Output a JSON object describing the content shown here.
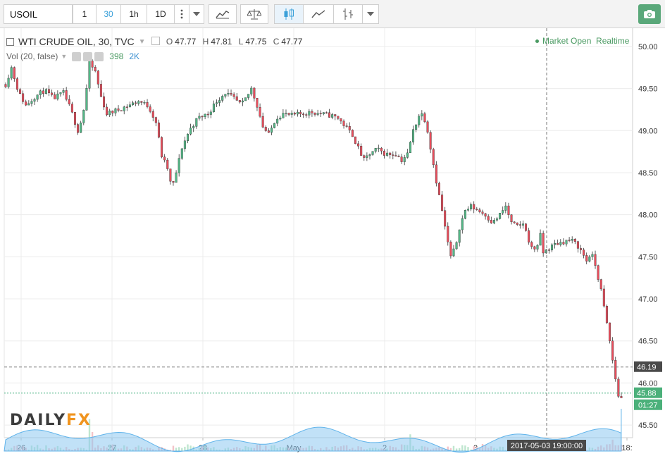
{
  "toolbar": {
    "symbol": "USOIL",
    "intervals": [
      "1",
      "30",
      "1h",
      "1D"
    ],
    "active_interval": "30",
    "tools": [
      "more-vert-icon",
      "chevron-down-icon",
      "indicators-icon",
      "compare-icon",
      "candles-icon",
      "area-icon",
      "bars-icon",
      "chevron-down-icon"
    ],
    "camera_icon": "camera-icon"
  },
  "legend": {
    "title": "WTI CRUDE OIL, 30, TVC",
    "o_label": "O",
    "o": "47.77",
    "h_label": "H",
    "h": "47.81",
    "l_label": "L",
    "l": "47.75",
    "c_label": "C",
    "c": "47.77",
    "vol_label": "Vol (20, false)",
    "vol_value": "398",
    "vol_ma": "2K",
    "status": "Market Open",
    "feed": "Realtime"
  },
  "logo": {
    "part1": "DAILY",
    "part2": "FX"
  },
  "chart_data": {
    "type": "candlestick",
    "title": "WTI CRUDE OIL, 30, TVC",
    "ylim": [
      45.35,
      50.1
    ],
    "y_ticks": [
      "50.00",
      "49.50",
      "49.00",
      "48.50",
      "48.00",
      "47.50",
      "47.00",
      "46.50",
      "46.00",
      "45.50"
    ],
    "x_ticks": [
      "26",
      "27",
      "28",
      "May",
      "2",
      "3",
      "18:"
    ],
    "x_range_days": [
      0,
      5.85
    ],
    "crosshair": {
      "time_label": "2017-05-03 19:00:00",
      "time_days": 5.78,
      "price_label": "46.19",
      "price": 46.19
    },
    "last_price": {
      "label": "45.88",
      "value": 45.88
    },
    "countdown": "01:27",
    "colors": {
      "up": "#53b987",
      "down": "#eb4d5c",
      "volume_ma": "#8ec8f0"
    },
    "price_path": [
      [
        0.0,
        49.55
      ],
      [
        0.04,
        49.75
      ],
      [
        0.09,
        49.45
      ],
      [
        0.14,
        49.3
      ],
      [
        0.2,
        49.4
      ],
      [
        0.27,
        49.48
      ],
      [
        0.33,
        49.38
      ],
      [
        0.4,
        49.45
      ],
      [
        0.45,
        49.25
      ],
      [
        0.5,
        49.0
      ],
      [
        0.53,
        49.15
      ],
      [
        0.55,
        49.35
      ],
      [
        0.58,
        49.8
      ],
      [
        0.62,
        49.7
      ],
      [
        0.66,
        49.4
      ],
      [
        0.7,
        49.2
      ],
      [
        0.78,
        49.25
      ],
      [
        0.85,
        49.3
      ],
      [
        0.92,
        49.35
      ],
      [
        0.98,
        49.3
      ],
      [
        1.0,
        49.25
      ],
      [
        1.04,
        49.1
      ],
      [
        1.08,
        48.7
      ],
      [
        1.12,
        48.55
      ],
      [
        1.15,
        48.3
      ],
      [
        1.18,
        48.5
      ],
      [
        1.22,
        48.8
      ],
      [
        1.27,
        49.0
      ],
      [
        1.33,
        49.15
      ],
      [
        1.4,
        49.2
      ],
      [
        1.46,
        49.35
      ],
      [
        1.52,
        49.45
      ],
      [
        1.58,
        49.38
      ],
      [
        1.63,
        49.3
      ],
      [
        1.67,
        49.4
      ],
      [
        1.7,
        49.5
      ],
      [
        1.74,
        49.3
      ],
      [
        1.78,
        49.05
      ],
      [
        1.82,
        48.95
      ],
      [
        1.87,
        49.15
      ],
      [
        1.92,
        49.2
      ],
      [
        1.98,
        49.18
      ],
      [
        2.05,
        49.2
      ],
      [
        2.12,
        49.22
      ],
      [
        2.18,
        49.2
      ],
      [
        2.25,
        49.18
      ],
      [
        2.3,
        49.15
      ],
      [
        2.35,
        49.05
      ],
      [
        2.4,
        48.95
      ],
      [
        2.45,
        48.75
      ],
      [
        2.48,
        48.65
      ],
      [
        2.52,
        48.72
      ],
      [
        2.57,
        48.78
      ],
      [
        2.63,
        48.72
      ],
      [
        2.7,
        48.72
      ],
      [
        2.74,
        48.65
      ],
      [
        2.78,
        48.72
      ],
      [
        2.82,
        49.0
      ],
      [
        2.86,
        49.18
      ],
      [
        2.89,
        49.2
      ],
      [
        2.92,
        49.0
      ],
      [
        2.95,
        48.7
      ],
      [
        2.98,
        48.4
      ],
      [
        3.02,
        48.05
      ],
      [
        3.05,
        47.75
      ],
      [
        3.08,
        47.5
      ],
      [
        3.11,
        47.6
      ],
      [
        3.14,
        47.85
      ],
      [
        3.18,
        48.05
      ],
      [
        3.22,
        48.1
      ],
      [
        3.27,
        48.05
      ],
      [
        3.32,
        48.0
      ],
      [
        3.37,
        47.9
      ],
      [
        3.42,
        48.0
      ],
      [
        3.46,
        48.1
      ],
      [
        3.5,
        47.9
      ],
      [
        3.55,
        47.85
      ],
      [
        3.58,
        47.9
      ],
      [
        3.61,
        47.75
      ],
      [
        3.64,
        47.6
      ],
      [
        3.67,
        47.6
      ],
      [
        3.7,
        47.75
      ],
      [
        3.72,
        47.55
      ],
      [
        3.76,
        47.6
      ],
      [
        3.8,
        47.65
      ],
      [
        3.86,
        47.68
      ],
      [
        3.91,
        47.7
      ],
      [
        3.95,
        47.65
      ],
      [
        3.99,
        47.55
      ],
      [
        4.02,
        47.45
      ],
      [
        4.05,
        47.55
      ],
      [
        4.08,
        47.4
      ],
      [
        4.12,
        47.1
      ],
      [
        4.15,
        46.8
      ],
      [
        4.18,
        46.5
      ],
      [
        4.21,
        46.15
      ],
      [
        4.25,
        45.75
      ],
      [
        4.27,
        45.88
      ]
    ],
    "volume_spikes": [
      {
        "day": 0.58,
        "height": 0.42
      },
      {
        "day": 0.6,
        "height": 0.25
      },
      {
        "day": 2.73,
        "height": 0.38
      },
      {
        "day": 2.8,
        "height": 0.22
      },
      {
        "day": 4.13,
        "height": 0.2
      },
      {
        "day": 4.2,
        "height": 0.15
      }
    ]
  }
}
